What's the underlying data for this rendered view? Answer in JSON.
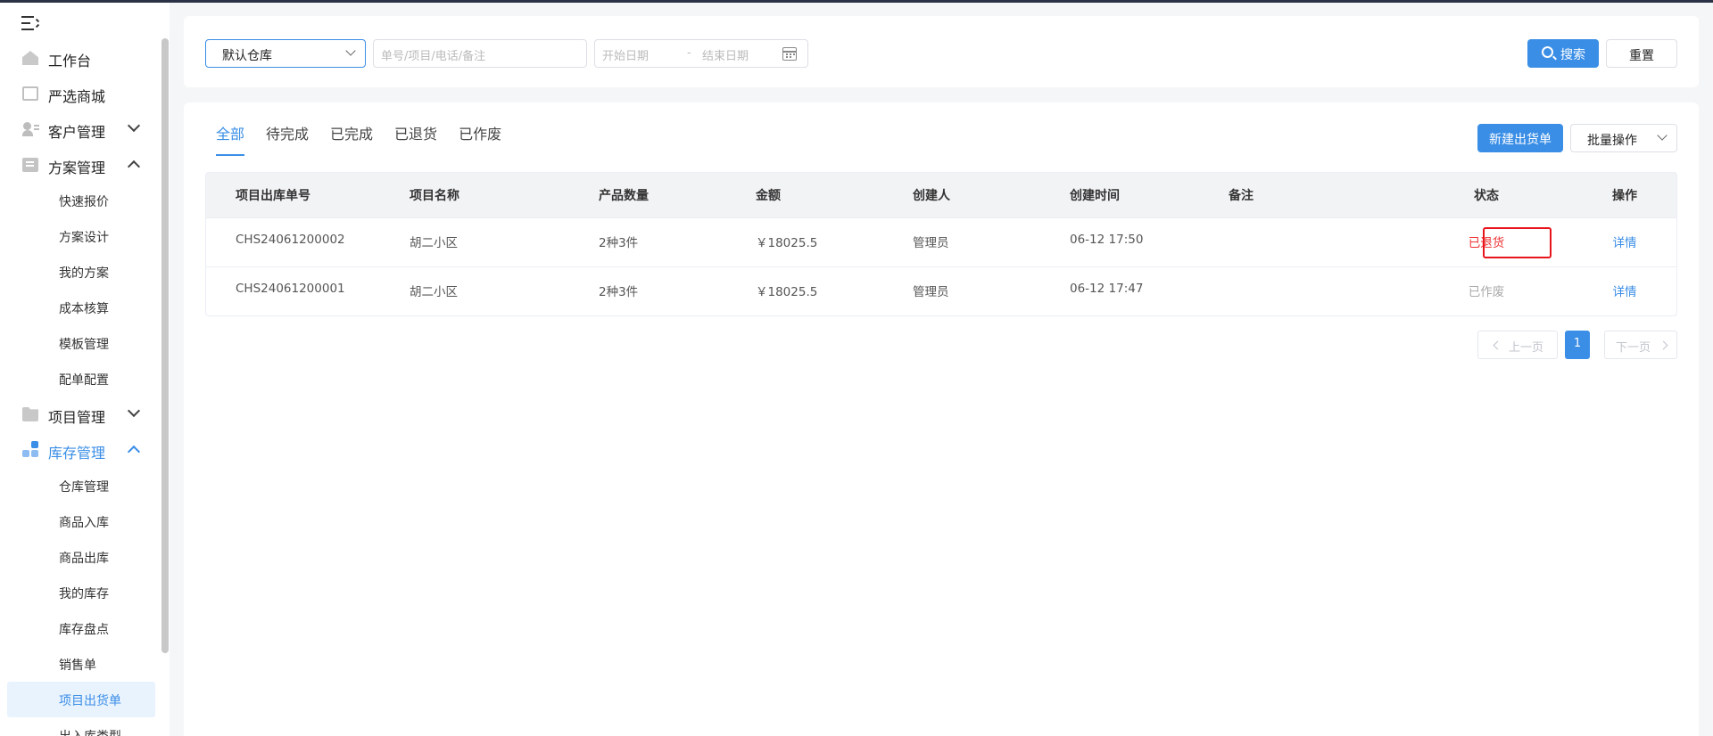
{
  "sidebar": {
    "menu": [
      {
        "label": "工作台",
        "icon": "home-icon"
      },
      {
        "label": "严选商城",
        "icon": "shop-icon"
      },
      {
        "label": "客户管理",
        "icon": "user-icon",
        "expanded": false
      },
      {
        "label": "方案管理",
        "icon": "document-icon",
        "expanded": true,
        "children": [
          "快速报价",
          "方案设计",
          "我的方案",
          "成本核算",
          "模板管理",
          "配单配置"
        ]
      },
      {
        "label": "项目管理",
        "icon": "folder-icon",
        "expanded": false
      },
      {
        "label": "库存管理",
        "icon": "stock-icon",
        "expanded": true,
        "active": true,
        "children": [
          "仓库管理",
          "商品入库",
          "商品出库",
          "我的库存",
          "库存盘点",
          "销售单",
          "项目出货单",
          "出入库类型"
        ]
      }
    ],
    "selected_item": "项目出货单"
  },
  "filters": {
    "warehouse": "默认仓库",
    "keyword_placeholder": "单号/项目/电话/备注",
    "start_date_placeholder": "开始日期",
    "date_separator": "-",
    "end_date_placeholder": "结束日期",
    "search_label": "搜索",
    "reset_label": "重置"
  },
  "tabs": [
    "全部",
    "待完成",
    "已完成",
    "已退货",
    "已作废"
  ],
  "active_tab": "全部",
  "actions": {
    "new_label": "新建出货单",
    "batch_label": "批量操作"
  },
  "table": {
    "columns": [
      "项目出库单号",
      "项目名称",
      "产品数量",
      "金额",
      "创建人",
      "创建时间",
      "备注",
      "状态",
      "操作"
    ],
    "rows": [
      {
        "no": "CHS24061200002",
        "project": "胡二小区",
        "qty": "2种3件",
        "amount": "￥18025.5",
        "creator": "管理员",
        "time": "06-12 17:50",
        "note": "",
        "status": "已退货",
        "op": "详情"
      },
      {
        "no": "CHS24061200001",
        "project": "胡二小区",
        "qty": "2种3件",
        "amount": "￥18025.5",
        "creator": "管理员",
        "time": "06-12 17:47",
        "note": "",
        "status": "已作废",
        "op": "详情"
      }
    ]
  },
  "pagination": {
    "prev_label": "上一页",
    "current_page": "1",
    "next_label": "下一页"
  },
  "colors": {
    "accent": "#3a8ee6",
    "returned": "#e33333",
    "void": "#aaaaaa",
    "highlight_box": "#e8141b"
  }
}
